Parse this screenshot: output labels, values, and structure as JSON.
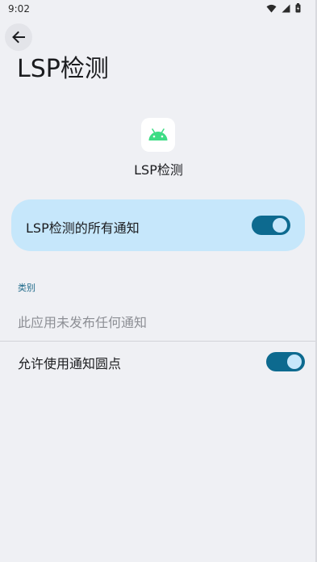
{
  "status_bar": {
    "time": "9:02",
    "icons": [
      "wifi-icon",
      "signal-icon",
      "battery-icon"
    ]
  },
  "header": {
    "back_icon": "arrow-left-icon",
    "title": "LSP检测"
  },
  "app": {
    "icon": "android-icon",
    "name": "LSP检测"
  },
  "master_toggle": {
    "label": "LSP检测的所有通知",
    "enabled": true
  },
  "categories": {
    "heading": "类别",
    "empty_text": "此应用未发布任何通知"
  },
  "notification_dot": {
    "label": "允许使用通知圆点",
    "enabled": true
  },
  "colors": {
    "background": "#eff0f4",
    "card": "#c6e7fb",
    "accent": "#0d6a8f",
    "android_green": "#3ddc84"
  }
}
